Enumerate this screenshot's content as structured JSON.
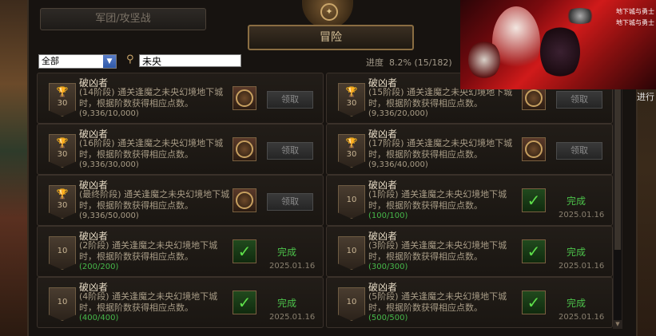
{
  "tabs": {
    "legion": "军团/攻坚战",
    "adventure": "冒险"
  },
  "filter": {
    "selected": "全部"
  },
  "search": {
    "value": "未央"
  },
  "progress": {
    "label": "进度",
    "value": "8.2% (15/182)"
  },
  "side_text": "进行",
  "ad_logo": "地下城与勇士",
  "achievements": [
    {
      "title": "破凶者",
      "desc": "(14阶段) 通关逢魔之未央幻境地下城时，根据阶数获得相应点数。",
      "count": "(9,336/10,000)",
      "badge": "30",
      "state": "claim",
      "action": "领取",
      "date": ""
    },
    {
      "title": "破凶者",
      "desc": "(15阶段) 通关逢魔之未央幻境地下城时，根据阶数获得相应点数。",
      "count": "(9,336/20,000)",
      "badge": "30",
      "state": "claim",
      "action": "领取",
      "date": ""
    },
    {
      "title": "破凶者",
      "desc": "(16阶段) 通关逢魔之未央幻境地下城时，根据阶数获得相应点数。",
      "count": "(9,336/30,000)",
      "badge": "30",
      "state": "claim",
      "action": "领取",
      "date": ""
    },
    {
      "title": "破凶者",
      "desc": "(17阶段) 通关逢魔之未央幻境地下城时，根据阶数获得相应点数。",
      "count": "(9,336/40,000)",
      "badge": "30",
      "state": "claim",
      "action": "领取",
      "date": ""
    },
    {
      "title": "破凶者",
      "desc": "(最终阶段) 通关逢魔之未央幻境地下城时，根据阶数获得相应点数。",
      "count": "(9,336/50,000)",
      "badge": "30",
      "state": "claim",
      "action": "领取",
      "date": ""
    },
    {
      "title": "破凶者",
      "desc": "(1阶段) 通关逢魔之未央幻境地下城时，根据阶数获得相应点数。",
      "count": "(100/100)",
      "badge": "10",
      "state": "done",
      "action": "完成",
      "date": "2025.01.16"
    },
    {
      "title": "破凶者",
      "desc": "(2阶段) 通关逢魔之未央幻境地下城时，根据阶数获得相应点数。",
      "count": "(200/200)",
      "badge": "10",
      "state": "done",
      "action": "完成",
      "date": "2025.01.16"
    },
    {
      "title": "破凶者",
      "desc": "(3阶段) 通关逢魔之未央幻境地下城时，根据阶数获得相应点数。",
      "count": "(300/300)",
      "badge": "10",
      "state": "done",
      "action": "完成",
      "date": "2025.01.16"
    },
    {
      "title": "破凶者",
      "desc": "(4阶段) 通关逢魔之未央幻境地下城时，根据阶数获得相应点数。",
      "count": "(400/400)",
      "badge": "10",
      "state": "done",
      "action": "完成",
      "date": "2025.01.16"
    },
    {
      "title": "破凶者",
      "desc": "(5阶段) 通关逢魔之未央幻境地下城时，根据阶数获得相应点数。",
      "count": "(500/500)",
      "badge": "10",
      "state": "done",
      "action": "完成",
      "date": "2025.01.16"
    }
  ]
}
